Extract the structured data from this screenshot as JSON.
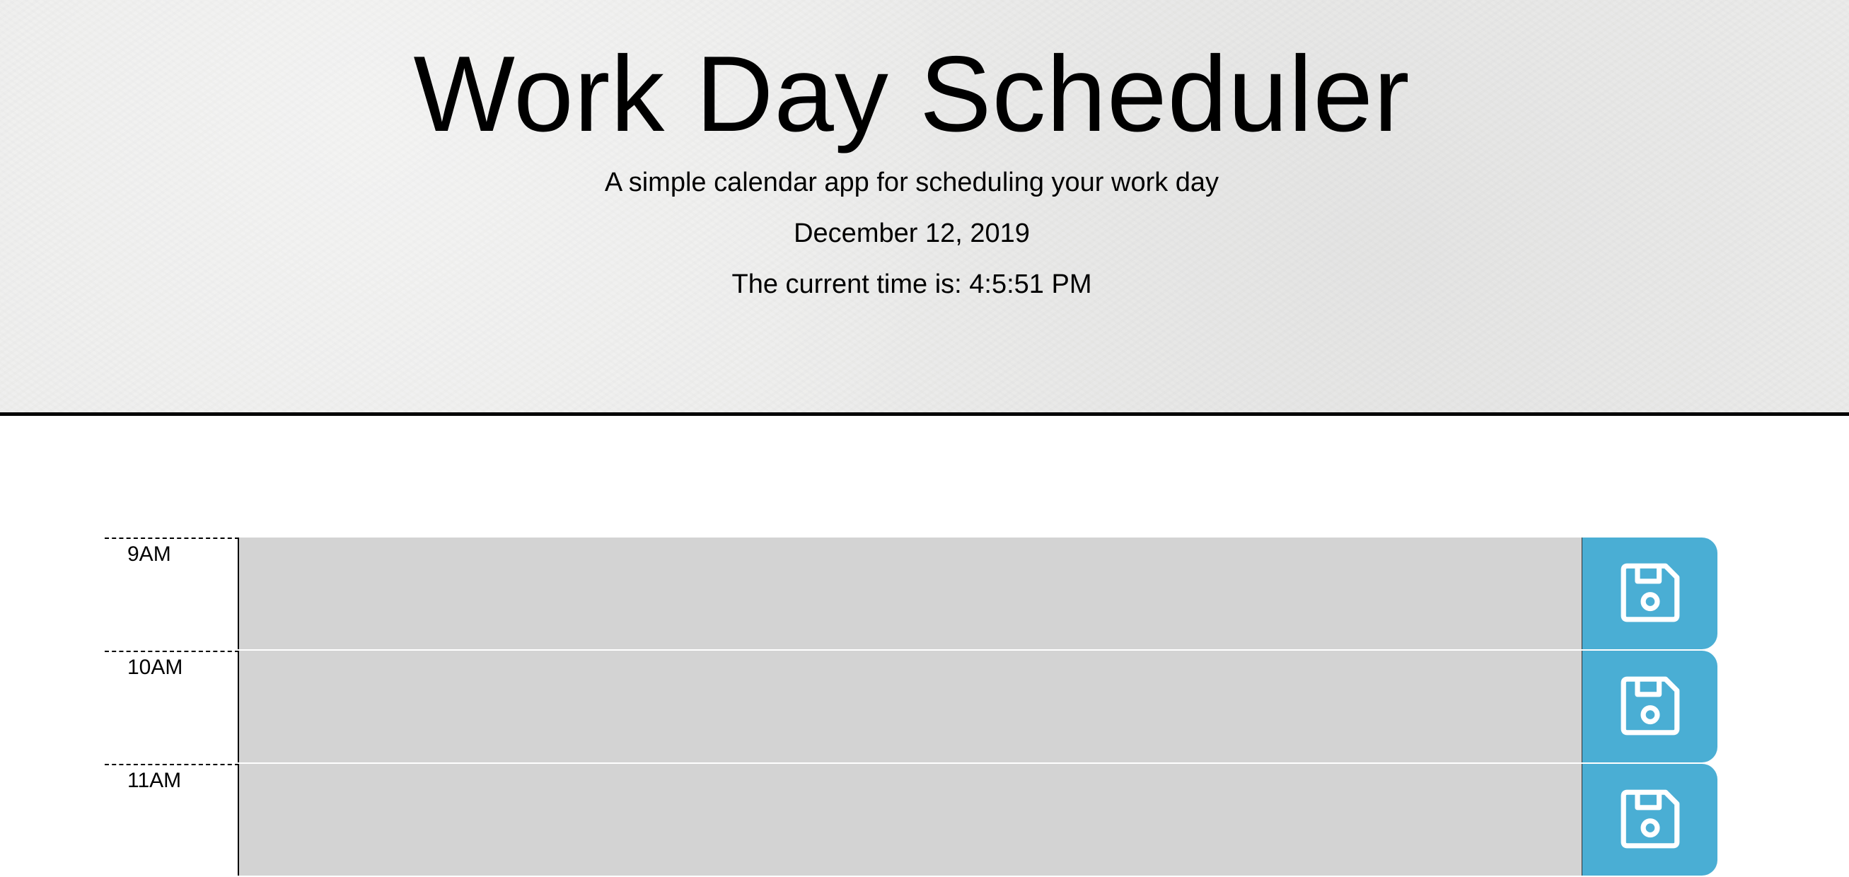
{
  "header": {
    "title": "Work Day Scheduler",
    "subtitle": "A simple calendar app for scheduling your work day",
    "date": "December 12, 2019",
    "current_time": "The current time is: 4:5:51 PM"
  },
  "colors": {
    "header_bg": "#ededec",
    "past_block": "#d3d3d3",
    "save_button": "#4aaed4"
  },
  "time_blocks": [
    {
      "hour": "9AM",
      "text": "",
      "status": "past",
      "save_icon": "floppy-disk-icon"
    },
    {
      "hour": "10AM",
      "text": "",
      "status": "past",
      "save_icon": "floppy-disk-icon"
    },
    {
      "hour": "11AM",
      "text": "",
      "status": "past",
      "save_icon": "floppy-disk-icon"
    }
  ]
}
